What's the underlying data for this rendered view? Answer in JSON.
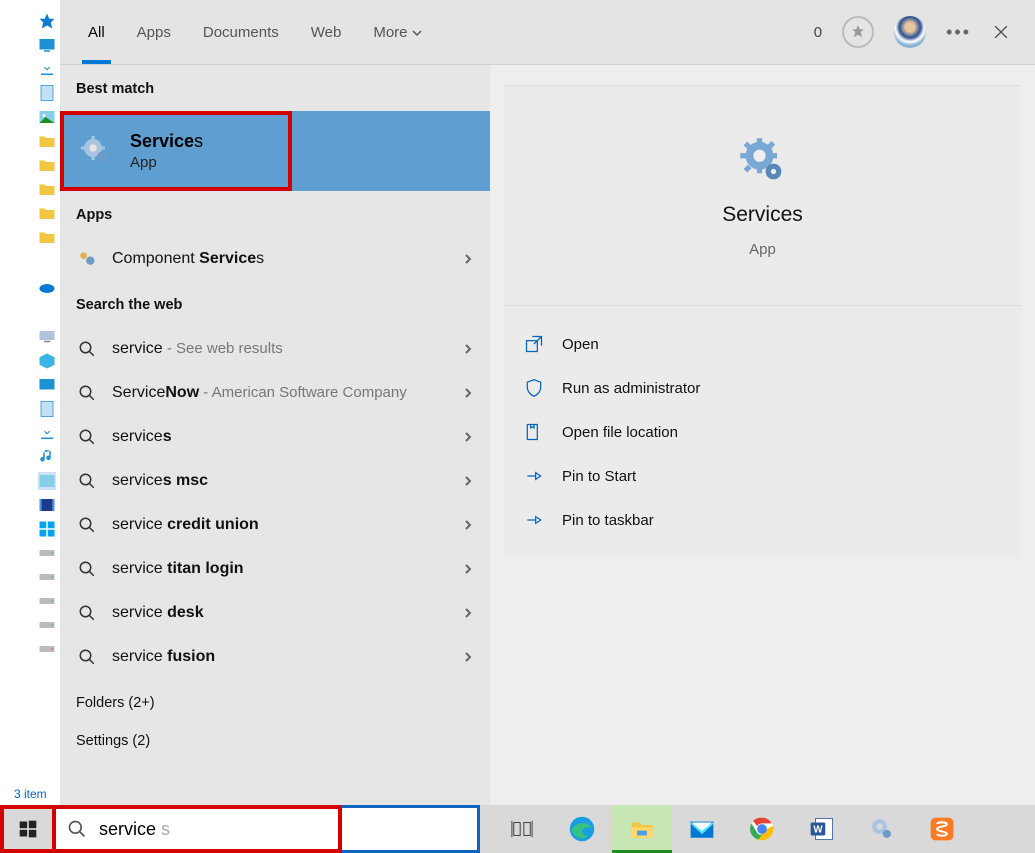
{
  "header": {
    "tabs": [
      "All",
      "Apps",
      "Documents",
      "Web",
      "More"
    ],
    "active_tab": "All",
    "score": "0"
  },
  "sections": {
    "best_match_label": "Best match",
    "apps_label": "Apps",
    "search_web_label": "Search the web",
    "folders_label": "Folders (2+)",
    "settings_label": "Settings (2)"
  },
  "best_match": {
    "title_match": "Service",
    "title_rest": "s",
    "subtitle": "App"
  },
  "apps": [
    {
      "prefix": "Component ",
      "bold": "Service",
      "suffix": "s"
    }
  ],
  "web": [
    {
      "pre": "service",
      "bold": "",
      "suf": "",
      "desc": " - See web results"
    },
    {
      "pre": "Service",
      "bold": "Now",
      "suf": "",
      "desc": " - American Software Company"
    },
    {
      "pre": "service",
      "bold": "s",
      "suf": "",
      "desc": ""
    },
    {
      "pre": "service",
      "bold": "s msc",
      "suf": "",
      "desc": ""
    },
    {
      "pre": "service ",
      "bold": "credit union",
      "suf": "",
      "desc": ""
    },
    {
      "pre": "service ",
      "bold": "titan login",
      "suf": "",
      "desc": ""
    },
    {
      "pre": "service ",
      "bold": "desk",
      "suf": "",
      "desc": ""
    },
    {
      "pre": "service ",
      "bold": "fusion",
      "suf": "",
      "desc": ""
    }
  ],
  "preview": {
    "title": "Services",
    "subtitle": "App",
    "actions": [
      "Open",
      "Run as administrator",
      "Open file location",
      "Pin to Start",
      "Pin to taskbar"
    ]
  },
  "searchbox": {
    "value": "service",
    "ghost": "s"
  },
  "selection": "3 item"
}
